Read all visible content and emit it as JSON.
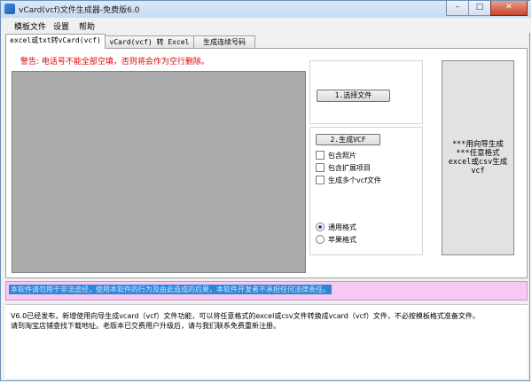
{
  "window": {
    "title": "vCard(vcf)文件生成器-免费版6.0",
    "minimize": "–",
    "maximize": "□",
    "close": "✕"
  },
  "menu": [
    "模板文件",
    "设置",
    "帮助"
  ],
  "tabs": [
    "excel或txt转vCard(vcf)",
    "vCard(vcf) 转 Excel",
    "生成连续号码"
  ],
  "warning": "警告: 电话号不能全部空填，否则将会作为空行删除。",
  "buttons": {
    "select_file": "1.选择文件",
    "generate_vcf": "2.生成VCF",
    "wizard": "***用向导生成***任意格式excel或csv生成vcf"
  },
  "checkboxes": [
    "包含照片",
    "包含扩展项目",
    "生成多个vcf文件"
  ],
  "radios": [
    {
      "label": "通用格式",
      "checked": true
    },
    {
      "label": "苹果格式",
      "checked": false
    }
  ],
  "marquee": "本软件请勿用于非法途径，使用本软件的行为及由此造成的后果，本软件开发者不承担任何法律责任。",
  "info": [
    "V6.0已经发布，新增使用向导生成vcard（vcf）文件功能，可以将任意格式的excel或csv文件转换成vcard（vcf）文件，不必按模板格式准备文件。",
    "请到淘宝店铺查找下载地址。老版本已交费用户升级后，请与我们联系免费重新注册。"
  ]
}
